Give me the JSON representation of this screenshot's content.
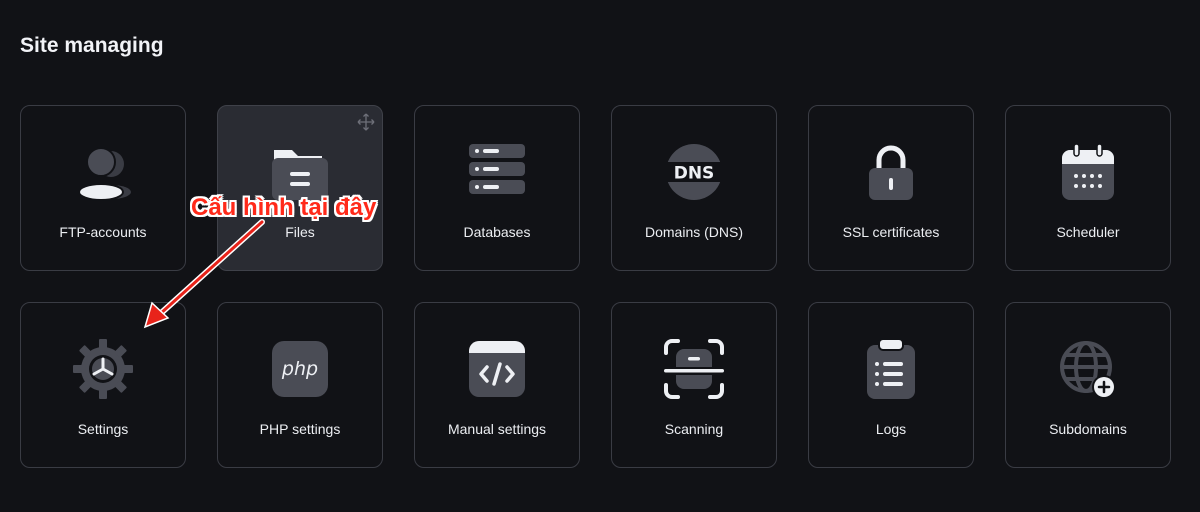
{
  "page": {
    "title": "Site managing"
  },
  "tiles": [
    {
      "label": "FTP-accounts",
      "icon": "users-icon"
    },
    {
      "label": "Files",
      "icon": "folder-icon"
    },
    {
      "label": "Databases",
      "icon": "database-icon"
    },
    {
      "label": "Domains (DNS)",
      "icon": "dns-icon"
    },
    {
      "label": "SSL certificates",
      "icon": "lock-icon"
    },
    {
      "label": "Scheduler",
      "icon": "calendar-icon"
    },
    {
      "label": "Settings",
      "icon": "gear-icon"
    },
    {
      "label": "PHP settings",
      "icon": "php-icon"
    },
    {
      "label": "Manual settings",
      "icon": "code-icon"
    },
    {
      "label": "Scanning",
      "icon": "scan-icon"
    },
    {
      "label": "Logs",
      "icon": "clipboard-icon"
    },
    {
      "label": "Subdomains",
      "icon": "globe-plus-icon"
    }
  ],
  "annotation": {
    "text": "Cấu hình tại đây",
    "color": "#ff2a1a"
  },
  "colors": {
    "background": "#111216",
    "tile_border": "#3a3c44",
    "icon": "#4a4c55",
    "hover_tile": "#2a2c33"
  }
}
